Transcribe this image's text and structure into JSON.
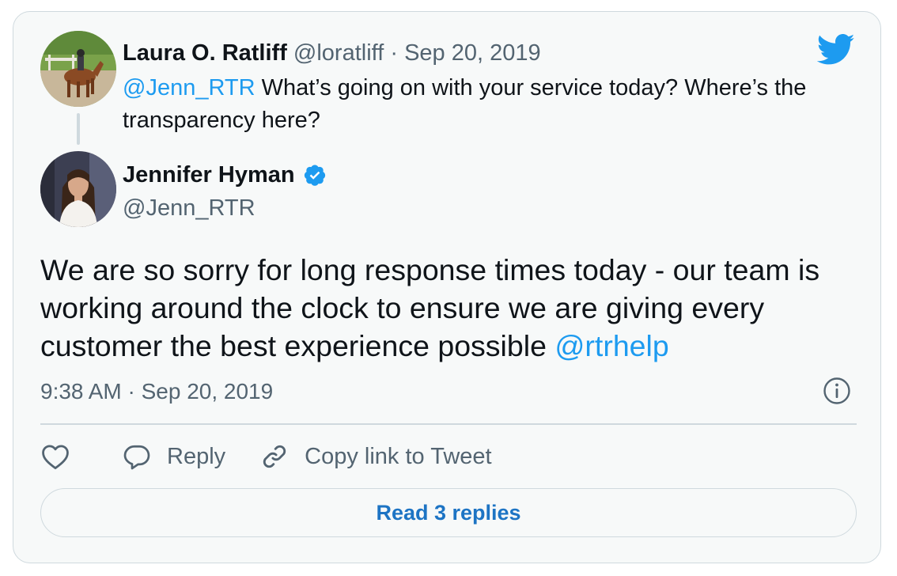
{
  "parent_tweet": {
    "author_name": "Laura O. Ratliff",
    "author_handle": "@loratliff",
    "separator": "·",
    "date": "Sep 20, 2019",
    "mention": "@Jenn_RTR",
    "text": " What’s going on with your service today? Where’s the transparency here?",
    "avatar_icon": "horse-rider-avatar"
  },
  "main_tweet": {
    "author_name": "Jennifer Hyman",
    "author_handle": "@Jenn_RTR",
    "verified": true,
    "text": "We are so sorry for long response times today - our team is working around the clock to ensure we are giving every customer the best experience possible ",
    "mention": "@rtrhelp",
    "timestamp": "9:38 AM · Sep 20, 2019",
    "avatar_icon": "woman-portrait-avatar"
  },
  "actions": {
    "like_icon": "heart-icon",
    "reply_label": "Reply",
    "reply_icon": "speech-bubble-icon",
    "copy_link_label": "Copy link to Tweet",
    "copy_link_icon": "link-icon"
  },
  "read_replies_label": "Read 3 replies",
  "icons": {
    "brand": "twitter-bird-icon",
    "info": "info-icon",
    "verified": "verified-badge-icon"
  },
  "colors": {
    "accent": "#1d9bf0",
    "text": "#0f1419",
    "muted": "#536471",
    "border": "#cfd9de",
    "background": "#f7f9f9",
    "replies_link": "#1d74c4"
  }
}
